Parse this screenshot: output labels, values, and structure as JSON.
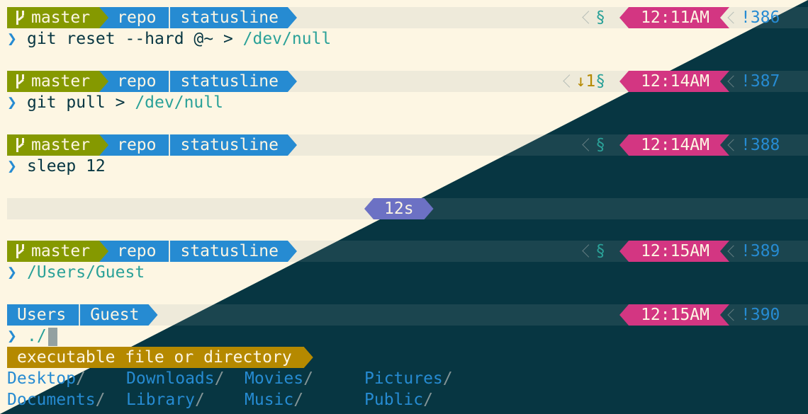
{
  "theme": {
    "bg_light": "#fdf6e3",
    "bg_dark": "#073642",
    "git_green": "#859900",
    "dir_blue": "#268bd2",
    "time_magenta": "#d33682",
    "duration_violet": "#6c71c4",
    "hint_yellow": "#b58900",
    "cyan": "#2aa198"
  },
  "blocks": [
    {
      "statusline": {
        "branch": "master",
        "path": [
          "repo",
          "statusline"
        ],
        "git_status": "§",
        "time": "12:11AM",
        "history": "!386"
      },
      "command": {
        "prompt": "❯",
        "text": "git reset --hard @~ > ",
        "path": "/dev/null"
      }
    },
    {
      "statusline": {
        "branch": "master",
        "path": [
          "repo",
          "statusline"
        ],
        "behind": "↓1",
        "git_status": "§",
        "time": "12:14AM",
        "history": "!387"
      },
      "command": {
        "prompt": "❯",
        "text": "git pull > ",
        "path": "/dev/null"
      }
    },
    {
      "statusline": {
        "branch": "master",
        "path": [
          "repo",
          "statusline"
        ],
        "git_status": "§",
        "time": "12:14AM",
        "history": "!388"
      },
      "command": {
        "prompt": "❯",
        "text": "sleep 12",
        "path": ""
      }
    },
    {
      "statusline": {
        "branch": "master",
        "path": [
          "repo",
          "statusline"
        ],
        "git_status": "§",
        "time": "12:15AM",
        "history": "!389"
      },
      "command": {
        "prompt": "❯",
        "text": "",
        "path": "/Users/Guest"
      }
    },
    {
      "statusline": {
        "path": [
          "Users",
          "Guest"
        ],
        "time": "12:15AM",
        "history": "!390"
      },
      "command": {
        "prompt": "❯",
        "text": "",
        "path": "./"
      }
    }
  ],
  "duration": "12s",
  "completion_hint": "executable file or directory",
  "listing": [
    [
      "Desktop",
      "Downloads",
      "Movies",
      "Pictures"
    ],
    [
      "Documents",
      "Library",
      "Music",
      "Public"
    ]
  ],
  "slash": "/"
}
